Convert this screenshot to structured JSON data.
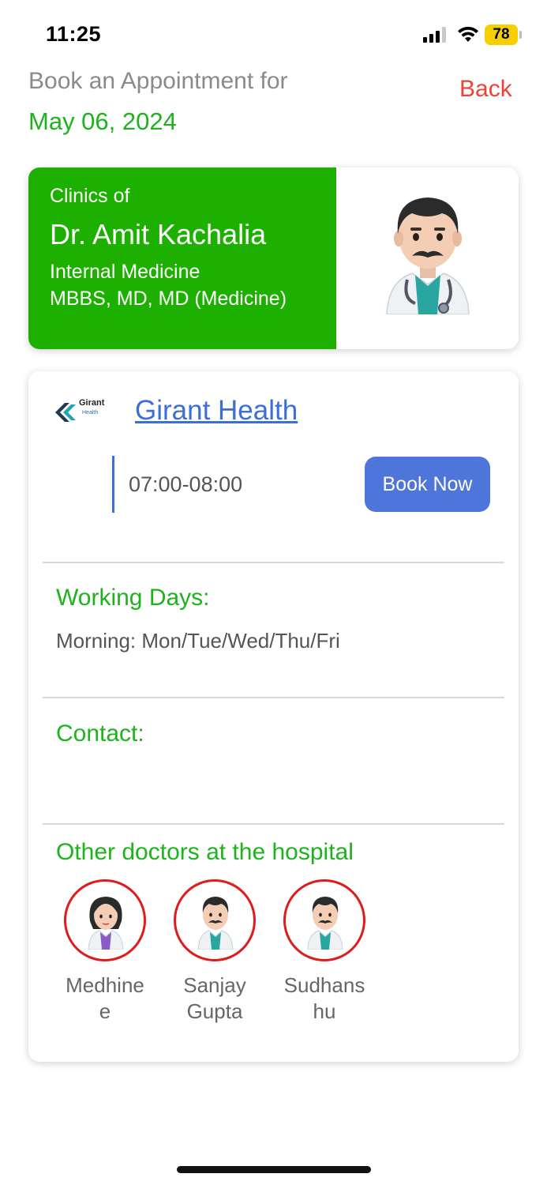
{
  "status_bar": {
    "time": "11:25",
    "battery": "78"
  },
  "header": {
    "title": "Book an Appointment for",
    "date": "May 06, 2024",
    "back_label": "Back"
  },
  "doctor": {
    "clinics_of": "Clinics of",
    "name": "Dr. Amit Kachalia",
    "specialty": "Internal Medicine",
    "degrees": "MBBS, MD, MD (Medicine)",
    "avatar_icon": "male-doctor-emoji-icon"
  },
  "hospital": {
    "logo_text": "Girant",
    "logo_subtext": "Health",
    "name": "Girant Health",
    "slot_time": "07:00-08:00",
    "book_label": "Book Now"
  },
  "working_days": {
    "label": "Working Days:",
    "value": "Morning: Mon/Tue/Wed/Thu/Fri"
  },
  "contact": {
    "label": "Contact:"
  },
  "other_doctors": {
    "label": "Other doctors at the hospital",
    "items": [
      {
        "name": "Medhinee",
        "icon": "female-doctor-emoji-icon"
      },
      {
        "name": "Sanjay Gupta",
        "icon": "male-doctor-emoji-icon"
      },
      {
        "name": "Sudhanshu",
        "icon": "male-doctor-emoji-icon"
      }
    ]
  },
  "colors": {
    "accent_green": "#1db31d",
    "card_green": "#1db000",
    "back_red": "#e8443a",
    "link_blue": "#3a6fd8",
    "button_blue": "#4e75d9",
    "avatar_ring": "#e01b1b",
    "battery_yellow": "#f6cf00"
  }
}
